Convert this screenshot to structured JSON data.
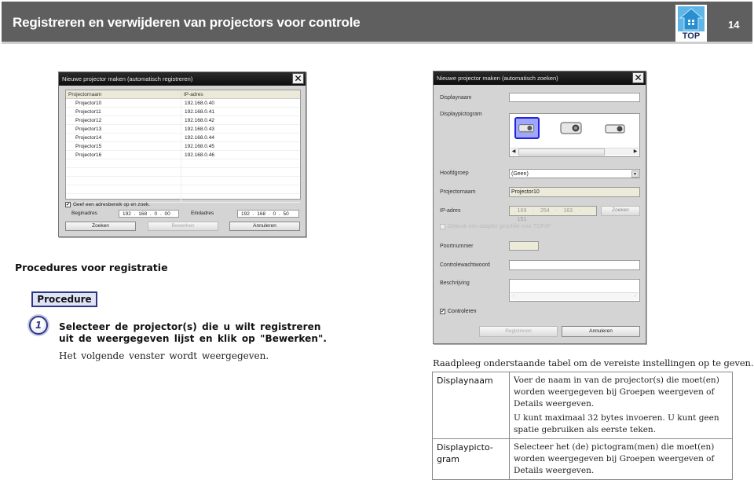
{
  "header": {
    "title": "Registreren en verwijderen van projectors voor controle",
    "top_label": "TOP",
    "page_number": "14"
  },
  "dialog_register": {
    "title": "Nieuwe projector maken (automatisch registreren)",
    "close_icon": "close-icon",
    "columns": [
      "Projectornaam",
      "IP-adres"
    ],
    "rows": [
      {
        "name": "Projector10",
        "ip": "192.168.0.40"
      },
      {
        "name": "Projector11",
        "ip": "192.168.0.41"
      },
      {
        "name": "Projector12",
        "ip": "192.168.0.42"
      },
      {
        "name": "Projector13",
        "ip": "192.168.0.43"
      },
      {
        "name": "Projector14",
        "ip": "192.168.0.44"
      },
      {
        "name": "Projector15",
        "ip": "192.168.0.45"
      },
      {
        "name": "Projector16",
        "ip": "192.168.0.46"
      }
    ],
    "range_checkbox_label": "Geef een adresbereik op en zoek.",
    "range_checked": true,
    "start_label": "Beginadres",
    "start_value": "192 . 168 . 0 . 00",
    "end_label": "Eindadres",
    "end_value": "192 . 168 . 0 . 50",
    "buttons": {
      "search": "Zoeken",
      "edit": "Bewerken",
      "cancel": "Annuleren"
    }
  },
  "dialog_search": {
    "title": "Nieuwe projector maken (automatisch zoeken)",
    "display_name_label": "Displaynaam",
    "display_name_value": "",
    "display_icon_label": "Displaypictogram",
    "icons": [
      "projector-icon-selected",
      "projector-icon-large",
      "projector-icon-small"
    ],
    "main_group_label": "Hoofdgroep",
    "main_group_value": "(Geen)",
    "projector_name_label": "Projectornaam",
    "projector_name_value": "Projector10",
    "ip_label": "IP-adres",
    "ip_segments": [
      "169",
      "254",
      "163",
      "151"
    ],
    "ip_search_button": "Zoeken",
    "adapter_checkbox_label": "Gebruik een adapter geschikt voor TCP/IP",
    "port_label": "Poortnummer",
    "port_value": "",
    "password_label": "Controlewachtwoord",
    "password_value": "",
    "description_label": "Beschrijving",
    "description_value": "",
    "control_checkbox_label": "Controleren",
    "control_checked": true,
    "buttons": {
      "register": "Registreren",
      "cancel": "Annuleren"
    }
  },
  "section_title": "Procedures voor registratie",
  "procedure_badge": "Procedure",
  "step": {
    "number": "1",
    "instruction": "Selecteer de projector(s) die u wilt registreren uit de weergegeven lijst en klik op \"Bewerken\".",
    "result": "Het volgende venster wordt weergegeven."
  },
  "table_intro": "Raadpleeg onderstaande tabel om de vereiste instellingen op te geven.",
  "settings_table": [
    {
      "key": "Displaynaam",
      "paragraphs": [
        "Voer de naam in van de projector(s) die moet(en) worden weergegeven bij Groepen weergeven of Details weergeven.",
        "U kunt maximaal 32 bytes invoeren. U kunt geen spatie gebruiken als eerste teken."
      ]
    },
    {
      "key": "Displaypicto-gram",
      "paragraphs": [
        "Selecteer het (de) pictogram(men) die moet(en) worden weergegeven bij Groepen weergeven of Details weergeven."
      ]
    }
  ]
}
